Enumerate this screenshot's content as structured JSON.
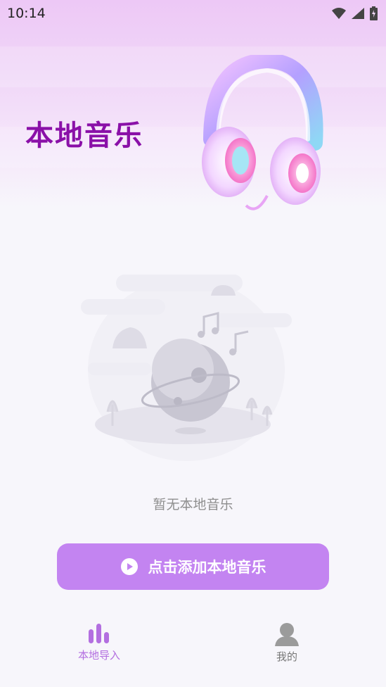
{
  "status_bar": {
    "time": "10:14",
    "icons": [
      "wifi-icon",
      "signal-icon",
      "battery-icon"
    ]
  },
  "header": {
    "title": "本地音乐",
    "image": "headphones-icon"
  },
  "empty_state": {
    "illustration": "planet-music-illustration",
    "message": "暂无本地音乐"
  },
  "add_button": {
    "label": "点击添加本地音乐",
    "icon": "play-circle-icon"
  },
  "bottom_nav": {
    "items": [
      {
        "label": "本地导入",
        "icon": "bars-icon",
        "active": true
      },
      {
        "label": "我的",
        "icon": "user-icon",
        "active": false
      }
    ]
  },
  "colors": {
    "accent": "#c384f1",
    "title": "#8a10a8",
    "nav_active": "#b36fe0"
  }
}
